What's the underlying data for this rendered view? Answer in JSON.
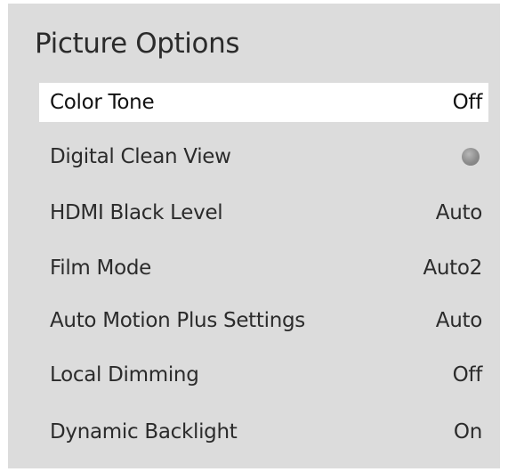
{
  "menu": {
    "title": "Picture Options",
    "items": [
      {
        "label": "Color Tone",
        "value": "Off"
      },
      {
        "label": "Digital Clean View",
        "value": null,
        "control": "toggle-off"
      },
      {
        "label": "HDMI Black Level",
        "value": "Auto"
      },
      {
        "label": "Film Mode",
        "value": "Auto2"
      },
      {
        "label": "Auto Motion Plus Settings",
        "value": "Auto"
      },
      {
        "label": "Local Dimming",
        "value": "Off"
      },
      {
        "label": "Dynamic Backlight",
        "value": "On"
      }
    ]
  },
  "colors": {
    "panel_bg": "#dcdcdc",
    "selected_bg": "#ffffff",
    "text": "#2b2b2b"
  }
}
